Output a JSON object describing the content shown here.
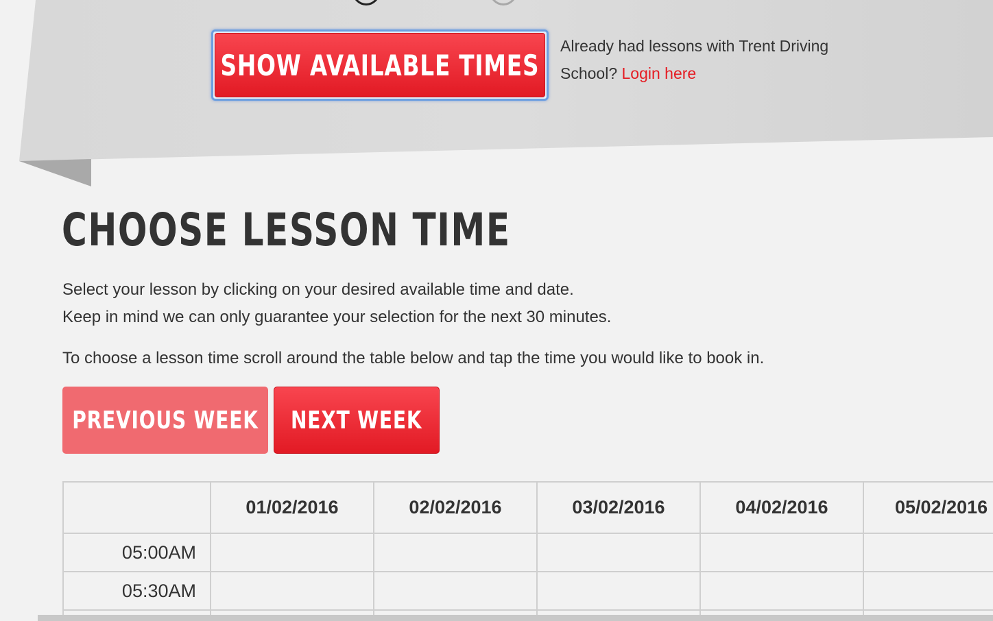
{
  "colors": {
    "accent_red": "#e51c23",
    "button_red": "#ef2b35",
    "button_red_disabled": "#f06a70",
    "page_bg": "#f2f2f2",
    "ribbon_grey": "#d6d6d6",
    "text_dark": "#333333",
    "focus_blue": "#6d9fe0"
  },
  "search_form": {
    "show_times_label": "SHOW AVAILABLE TIMES",
    "login_prompt": "Already had lessons with Trent Driving School?",
    "login_link": "Login here"
  },
  "lesson_section": {
    "title": "CHOOSE LESSON TIME",
    "instruction_line1": "Select your lesson by clicking on your desired available time and date.",
    "instruction_line2": "Keep in mind we can only guarantee your selection for the next 30 minutes.",
    "instruction_line3": "To choose a lesson time scroll around the table below and tap the time you would like to book in.",
    "previous_week_label": "PREVIOUS WEEK",
    "next_week_label": "NEXT WEEK",
    "previous_week_disabled": true
  },
  "schedule": {
    "dates": [
      "01/02/2016",
      "02/02/2016",
      "03/02/2016",
      "04/02/2016",
      "05/02/2016"
    ],
    "times": [
      "05:00AM",
      "05:30AM"
    ]
  }
}
